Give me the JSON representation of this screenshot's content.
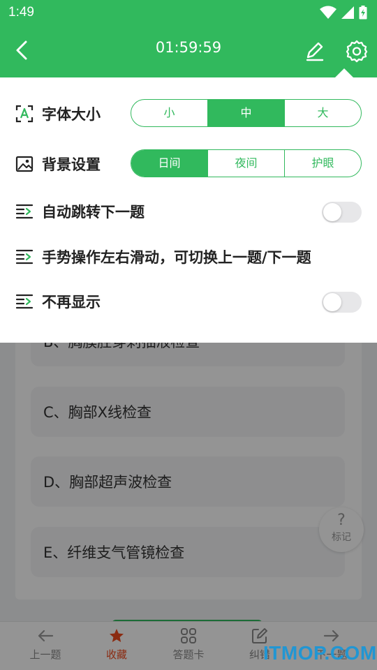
{
  "status_bar": {
    "time": "1:49"
  },
  "header": {
    "timer": "01:59:59"
  },
  "settings": {
    "font_size": {
      "label": "字体大小",
      "options": [
        "小",
        "中",
        "大"
      ],
      "selected": "中"
    },
    "background": {
      "label": "背景设置",
      "options": [
        "日间",
        "夜间",
        "护眼"
      ],
      "selected": "日间"
    },
    "auto_next": {
      "label": "自动跳转下一题",
      "enabled": false
    },
    "gesture": {
      "label": "手势操作左右滑动，可切换上一题/下一题"
    },
    "no_show": {
      "label": "不再显示",
      "enabled": false
    }
  },
  "question": {
    "options": [
      "B、胸膜腔穿刺抽液检查",
      "C、胸部X线检查",
      "D、胸部超声波检查",
      "E、纤维支气管镜检查"
    ]
  },
  "mark_button": {
    "label": "标记"
  },
  "bottom_nav": [
    {
      "label": "上一题",
      "icon": "arrow-left-icon"
    },
    {
      "label": "收藏",
      "icon": "star-icon",
      "active": true
    },
    {
      "label": "答题卡",
      "icon": "grid-icon"
    },
    {
      "label": "纠错",
      "icon": "edit-icon"
    },
    {
      "label": "下一题",
      "icon": "arrow-right-icon"
    }
  ],
  "watermark": "ITMOP.COM",
  "colors": {
    "primary": "#31b95d",
    "active": "#ef4b1e",
    "watermark": "#2196d3"
  }
}
